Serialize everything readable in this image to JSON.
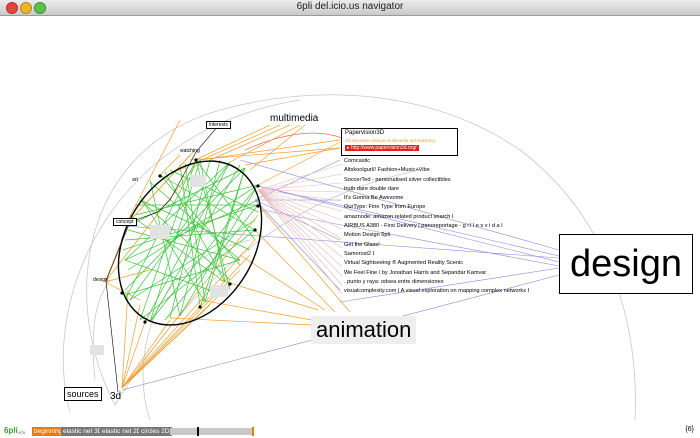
{
  "window": {
    "title": "6pli del.icio.us navigator"
  },
  "graph": {
    "categories": {
      "multimedia": "multimedia",
      "animation": "animation",
      "design": "design",
      "sources": "sources",
      "threeD": "3d",
      "interests": "interests",
      "watching": "watching",
      "art": "art",
      "concept": "concept"
    },
    "popup": {
      "title": "Papervision3D",
      "subtitle": "3d  animation  design  multimedia  ted  watching",
      "url": "▸ http://www.papervision3d.org/"
    },
    "bookmarks": [
      "Comcastic",
      "Altskoolgurl// Fashion+Music+Vibe",
      "SoccerTed - personalised silver collectibles",
      "truth dare double dare",
      "It's Gonna Be Awesome",
      "OurType: Fine Type from Europe",
      "amaznode: amazon related product search I",
      "AIRBUS A380 - First Delivery | panoreportage - g i l l e s v i d a l",
      "Motion Design 6pli",
      "Get the Glass!",
      "Samorost2 I",
      "Virtual Sightseeing ® Augmented Reality Scenic",
      "We Feel Fine / by Jonathan Harris and Sepandar Kamvar",
      ". punto y raya: odsea entre dimensiones",
      "visualcomplexity.com | A visual exploration on mapping complex networks I"
    ]
  },
  "toolbar": {
    "logo": "6pli",
    "logo_suffix": "alfa",
    "buttons": {
      "beginning": "beginning",
      "elastic3d": "elastic net 3D",
      "elastic2d": "elastic net 2D",
      "circles2d": "circles 2D"
    },
    "progress": 0.33,
    "corner": "{6}"
  },
  "colors": {
    "orange": "#f0a030",
    "green": "#3cc43c",
    "blue": "#8080d8",
    "pink": "#e8b0b0",
    "red": "#e32020"
  }
}
